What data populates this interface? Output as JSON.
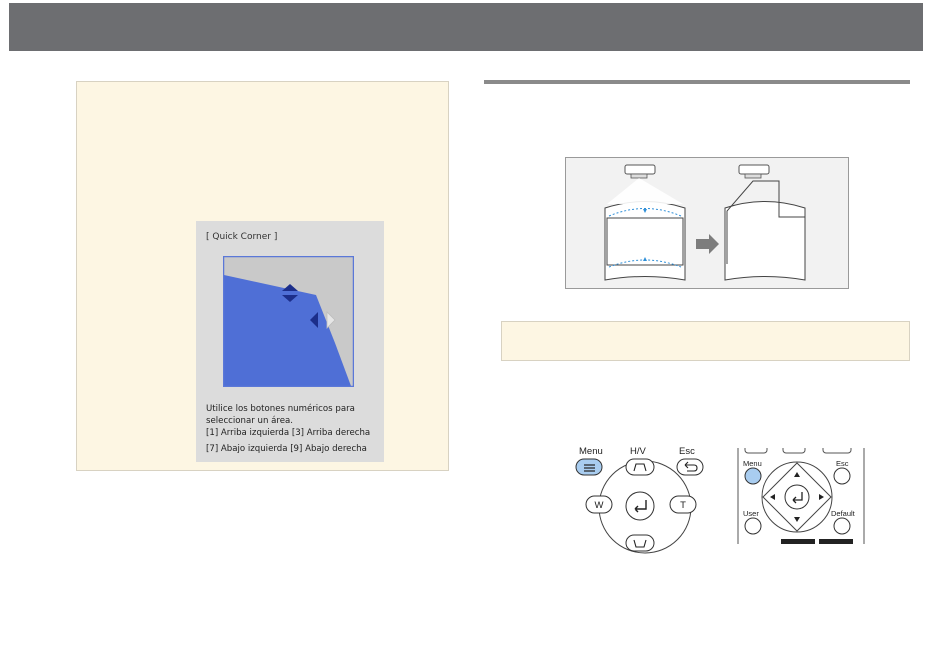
{
  "quick_corner": {
    "title": "[ Quick Corner ]",
    "instructions": [
      "Utilice los botones numéricos para",
      "seleccionar un área.",
      "[1] Arriba izquierda  [3] Arriba derecha",
      "[7] Abajo izquierda   [9] Abajo derecha"
    ]
  },
  "remote_control": {
    "menu_label": "Menu",
    "hv_label": "H/V",
    "esc_label": "Esc",
    "wide_label": "W",
    "tele_label": "T"
  },
  "projector_remote": {
    "menu_label": "Menu",
    "esc_label": "Esc",
    "user_label": "User",
    "default_label": "Default"
  },
  "colors": {
    "header_bar": "#6d6e71",
    "note_background": "#fdf6e3",
    "screen_blue": "#4f6fd6",
    "highlight_blue": "#a9cdf0"
  }
}
